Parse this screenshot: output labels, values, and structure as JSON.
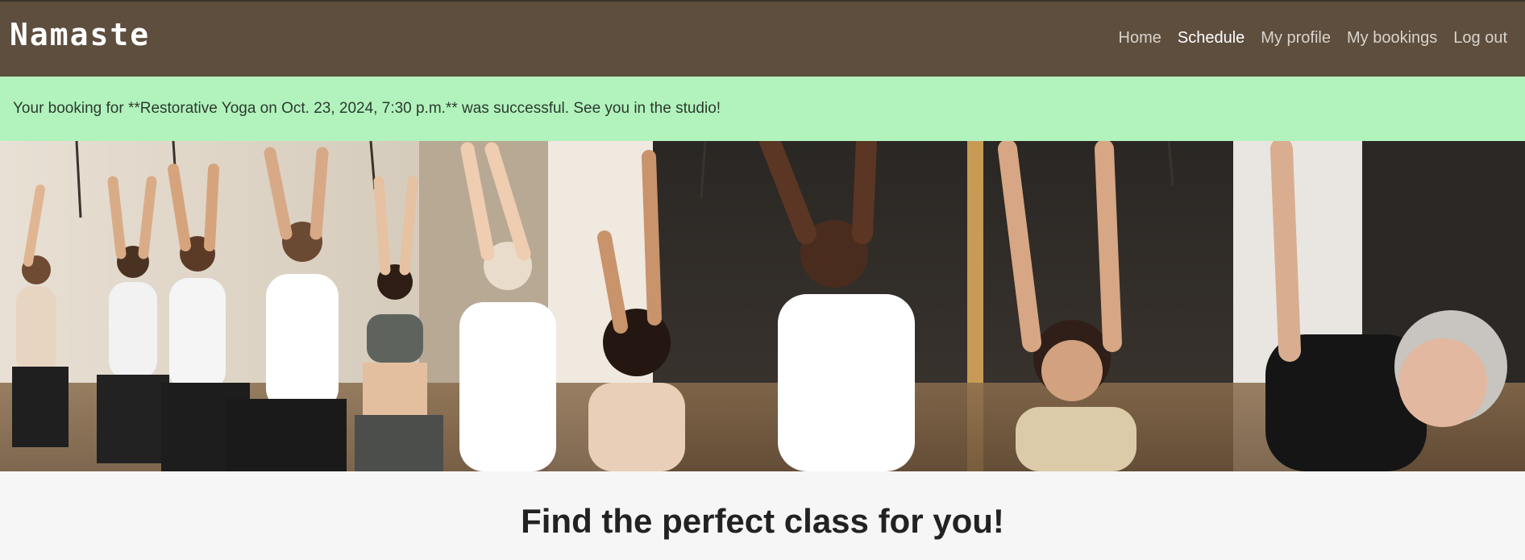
{
  "navbar": {
    "brand": "Namaste",
    "links": [
      {
        "label": "Home"
      },
      {
        "label": "Schedule"
      },
      {
        "label": "My profile"
      },
      {
        "label": "My bookings"
      },
      {
        "label": "Log out"
      }
    ],
    "active_link": "Schedule"
  },
  "alert": {
    "message": "Your booking for **Restorative Yoga on Oct. 23, 2024, 7:30 p.m.** was successful. See you in the studio!"
  },
  "main": {
    "headline": "Find the perfect class for you!"
  },
  "colors": {
    "navbar_bg": "#5d4e3e",
    "alert_bg": "#b2f3bd",
    "page_bg": "#f6f6f6"
  }
}
